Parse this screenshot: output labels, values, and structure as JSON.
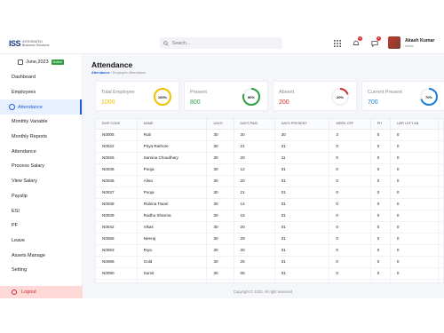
{
  "brand": {
    "mark": "ISS",
    "text_line1": "INTEGRATED",
    "text_line2": "Business Solutions"
  },
  "search": {
    "placeholder": "Search..."
  },
  "notifications": {
    "bell_count": "1",
    "message_count": "1"
  },
  "user": {
    "name": "Akash Kumar",
    "role": "Admin"
  },
  "sidebar": {
    "month": "June,2023",
    "month_status": "Active",
    "items": [
      {
        "label": "Dashboard"
      },
      {
        "label": "Employees"
      },
      {
        "label": "Attendance"
      },
      {
        "label": "Monthly Variable"
      },
      {
        "label": "Monthly Reports"
      },
      {
        "label": "Attendance"
      },
      {
        "label": "Process Salary"
      },
      {
        "label": "View Salary"
      },
      {
        "label": "Payslip"
      },
      {
        "label": "ESI"
      },
      {
        "label": "PF"
      },
      {
        "label": "Leave"
      },
      {
        "label": "Assets Manage"
      },
      {
        "label": "Setting"
      }
    ],
    "logout": "Logout"
  },
  "page": {
    "title": "Attendance",
    "breadcrumb": [
      "Attendance",
      "Employee Attendance"
    ]
  },
  "cards": [
    {
      "label": "Total Employee",
      "value": "1000",
      "percent": "100%",
      "pct_value": 100,
      "color": "#f2c200",
      "value_color": "#f2c200"
    },
    {
      "label": "Present",
      "value": "800",
      "percent": "80%",
      "pct_value": 80,
      "color": "#2f9e44",
      "value_color": "#2f9e44"
    },
    {
      "label": "Absent",
      "value": "200",
      "percent": "20%",
      "pct_value": 20,
      "color": "#c92a2a",
      "value_color": "#c92a2a"
    },
    {
      "label": "Current Present",
      "value": "700",
      "percent": "70%",
      "pct_value": 70,
      "color": "#1c7ed6",
      "value_color": "#1c7ed6"
    }
  ],
  "table": {
    "columns": [
      "EMP CODE",
      "NAME",
      "DAYS",
      "DAYS PAID",
      "DAYS PRESENT",
      "WEEK OFF",
      "PH",
      "LWR LEFT AB",
      "LWP",
      "A"
    ],
    "rows": [
      [
        "N0005",
        "Rub",
        "30",
        "30",
        "30",
        "3",
        "0",
        "0",
        "0",
        "0"
      ],
      [
        "N0022",
        "Priya Rathore",
        "30",
        "21",
        "21",
        "0",
        "0",
        "0",
        "0",
        "0"
      ],
      [
        "N0026",
        "Samina Choudhary",
        "30",
        "20",
        "11",
        "0",
        "0",
        "0",
        "0",
        "0"
      ],
      [
        "N0035",
        "Pooja",
        "30",
        "12",
        "01",
        "0",
        "0",
        "0",
        "0",
        "0"
      ],
      [
        "N0036",
        "Alina",
        "30",
        "20",
        "01",
        "0",
        "0",
        "0",
        "0",
        "0"
      ],
      [
        "N0037",
        "Pooja",
        "30",
        "21",
        "01",
        "0",
        "0",
        "0",
        "0",
        "0"
      ],
      [
        "N0038",
        "Rubina Tiwari",
        "30",
        "14",
        "01",
        "0",
        "0",
        "0",
        "0",
        "0"
      ],
      [
        "N0039",
        "Radha Sharma",
        "30",
        "15",
        "01",
        "0",
        "0",
        "0",
        "0",
        "0"
      ],
      [
        "N0042",
        "Vikas",
        "30",
        "20",
        "01",
        "0",
        "0",
        "0",
        "0",
        "0"
      ],
      [
        "N0058",
        "Neeraj",
        "30",
        "29",
        "01",
        "0",
        "0",
        "0",
        "0",
        "0"
      ],
      [
        "N0083",
        "Riya",
        "30",
        "30",
        "01",
        "0",
        "0",
        "0",
        "0",
        "0"
      ],
      [
        "N0088",
        "Gold",
        "30",
        "25",
        "01",
        "0",
        "0",
        "0",
        "0",
        "0"
      ],
      [
        "N0090",
        "Sumit",
        "30",
        "05",
        "01",
        "0",
        "0",
        "0",
        "0",
        "0"
      ],
      [
        "N0092",
        "Ravi Kumar",
        "30",
        "26",
        "01",
        "0",
        "0",
        "0",
        "0",
        "0"
      ],
      [
        "N0093",
        "Aparna Trivedi",
        "30",
        "22",
        "01",
        "0",
        "0",
        "0",
        "0",
        "0"
      ]
    ]
  },
  "footer": "Copyright © 2022. All right reserved."
}
